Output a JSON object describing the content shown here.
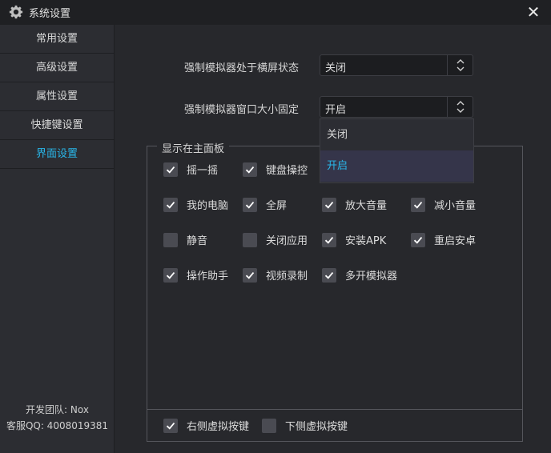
{
  "window": {
    "title": "系统设置",
    "close_glyph": "✕"
  },
  "sidebar": {
    "items": [
      {
        "label": "常用设置",
        "active": false
      },
      {
        "label": "高级设置",
        "active": false
      },
      {
        "label": "属性设置",
        "active": false
      },
      {
        "label": "快捷键设置",
        "active": false
      },
      {
        "label": "界面设置",
        "active": true
      }
    ],
    "footer": {
      "team": "开发团队: Nox",
      "support": "客服QQ: 4008019381"
    }
  },
  "settings": {
    "landscape": {
      "label": "强制模拟器处于横屏状态",
      "value": "关闭"
    },
    "fixed_size": {
      "label": "强制模拟器窗口大小固定",
      "value": "开启"
    }
  },
  "dropdown": {
    "options": [
      "关闭",
      "开启"
    ],
    "selected": "开启"
  },
  "main_panel": {
    "title": "显示在主面板",
    "items": [
      {
        "label": "摇一摇",
        "checked": true
      },
      {
        "label": "键盘操控",
        "checked": true
      },
      {
        "label": "我的电脑",
        "checked": true
      },
      {
        "label": "全屏",
        "checked": true
      },
      {
        "label": "放大音量",
        "checked": true
      },
      {
        "label": "减小音量",
        "checked": true
      },
      {
        "label": "静音",
        "checked": false
      },
      {
        "label": "关闭应用",
        "checked": false
      },
      {
        "label": "安装APK",
        "checked": true
      },
      {
        "label": "重启安卓",
        "checked": true
      },
      {
        "label": "操作助手",
        "checked": true
      },
      {
        "label": "视频录制",
        "checked": true
      },
      {
        "label": "多开模拟器",
        "checked": true
      }
    ],
    "bottom": [
      {
        "label": "右侧虚拟按键",
        "checked": true
      },
      {
        "label": "下侧虚拟按键",
        "checked": false
      }
    ]
  },
  "colors": {
    "accent": "#29b6e8",
    "background": "#27282c",
    "sidebar": "#2c2d32",
    "checkbox": "#4a4b52"
  }
}
